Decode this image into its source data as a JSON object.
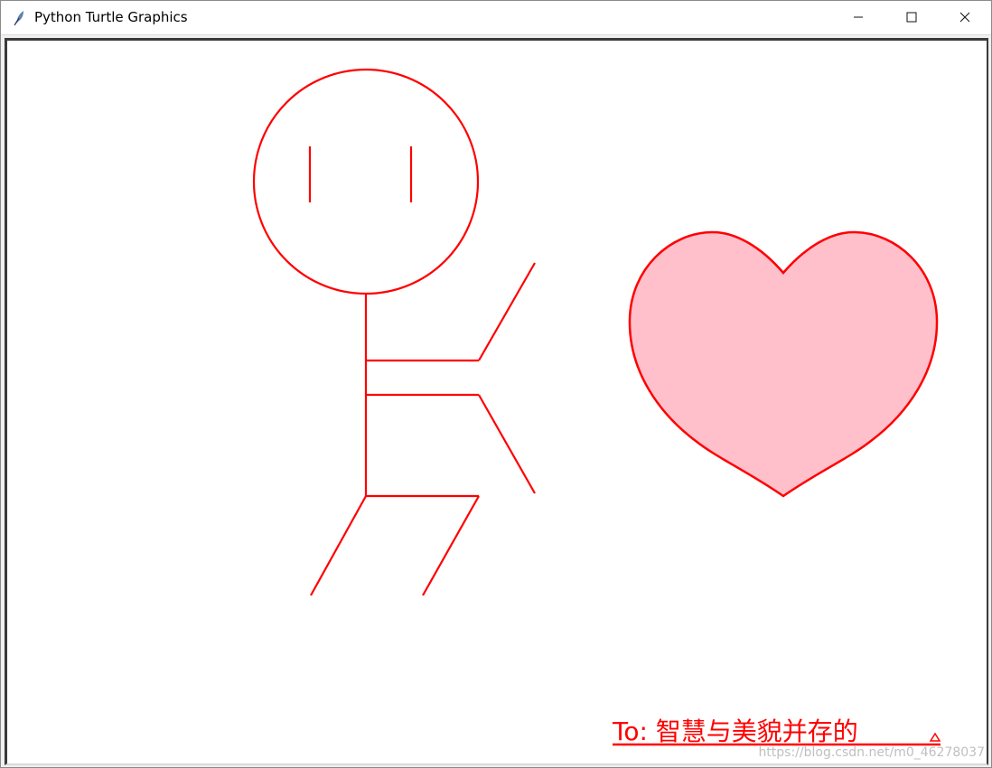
{
  "window": {
    "title": "Python Turtle Graphics",
    "app_icon": "feather-icon",
    "controls": {
      "minimize_icon": "minimize-icon",
      "maximize_icon": "maximize-icon",
      "close_icon": "close-icon"
    }
  },
  "canvas": {
    "background": "#ffffff",
    "stroke_color": "#ff0000",
    "heart_fill": "#ffc0cb",
    "message": "To: 智慧与美貌并存的"
  },
  "watermark": {
    "text": "https://blog.csdn.net/m0_46278037"
  }
}
